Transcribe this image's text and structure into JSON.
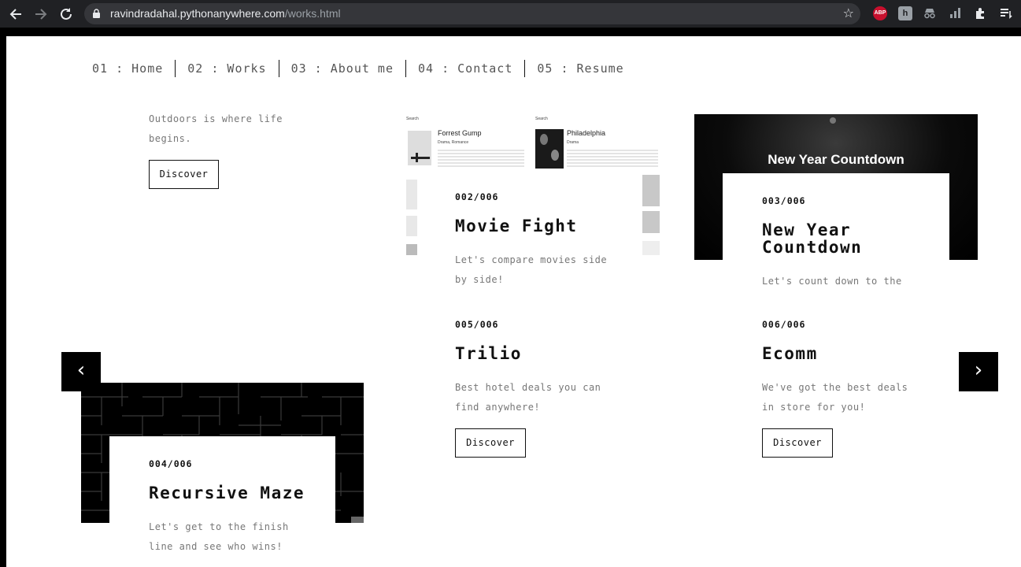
{
  "browser": {
    "url_host": "ravindradahal.pythonanywhere.com",
    "url_path": "/works.html",
    "ext_abp": "ABP",
    "ext_h": "h"
  },
  "nav": {
    "items": [
      {
        "label": "01 : Home"
      },
      {
        "label": "02 : Works"
      },
      {
        "label": "03 : About me"
      },
      {
        "label": "04 : Contact"
      },
      {
        "label": "05 : Resume"
      }
    ]
  },
  "carousel": {
    "prev_label": "‹",
    "next_label": "›"
  },
  "works": {
    "outdoors": {
      "desc_line1": "Outdoors is where life",
      "desc_line2": "begins.",
      "button": "Discover"
    },
    "movie_fight": {
      "number": "002/006",
      "title": "Movie Fight",
      "desc_line1": "Let's compare movies side",
      "desc_line2": "by side!",
      "shot": {
        "left_movie": "Forrest Gump",
        "left_genre": "Drama, Romance",
        "right_movie": "Philadelphia",
        "right_genre": "Drama",
        "search_label": "Search"
      }
    },
    "new_year": {
      "number": "003/006",
      "title_line1": "New Year",
      "title_line2": "Countdown",
      "desc_line1": "Let's count down to the",
      "shot_label": "New Year Countdown"
    },
    "maze": {
      "number": "004/006",
      "title": "Recursive Maze",
      "desc_line1": "Let's get to the finish",
      "desc_line2": "line and see who wins!"
    },
    "trilio": {
      "number": "005/006",
      "title": "Trilio",
      "desc_line1": "Best hotel deals you can",
      "desc_line2": "find anywhere!",
      "button": "Discover"
    },
    "ecomm": {
      "number": "006/006",
      "title": "Ecomm",
      "desc_line1": "We've got the best deals",
      "desc_line2": "in store for you!",
      "button": "Discover"
    }
  }
}
